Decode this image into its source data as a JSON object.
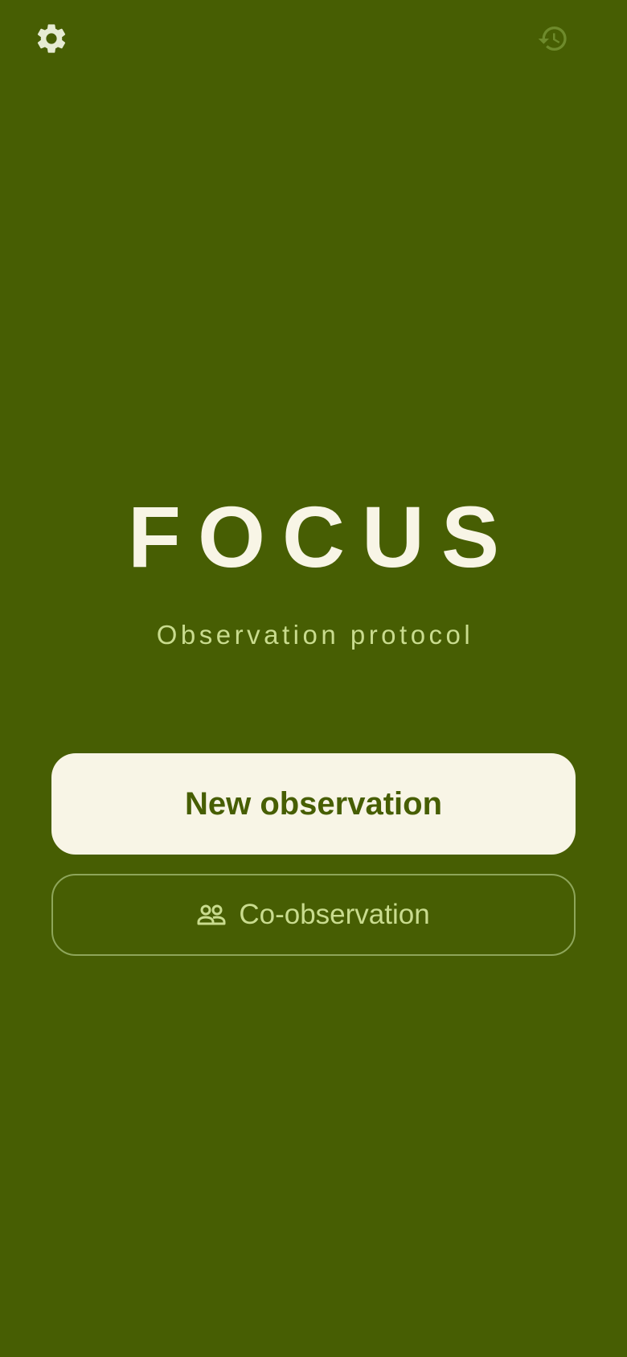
{
  "icons": {
    "settings": "gear-icon",
    "history": "history-icon",
    "co_observation": "group-icon"
  },
  "brand": {
    "title": "FOCUS",
    "subtitle": "Observation protocol"
  },
  "actions": {
    "new_observation_label": "New observation",
    "co_observation_label": "Co-observation"
  },
  "colors": {
    "background": "#475e03",
    "primary_button": "#f8f5e6",
    "accent_text": "#c9dc8e",
    "muted_icon": "#6e8a2c"
  }
}
